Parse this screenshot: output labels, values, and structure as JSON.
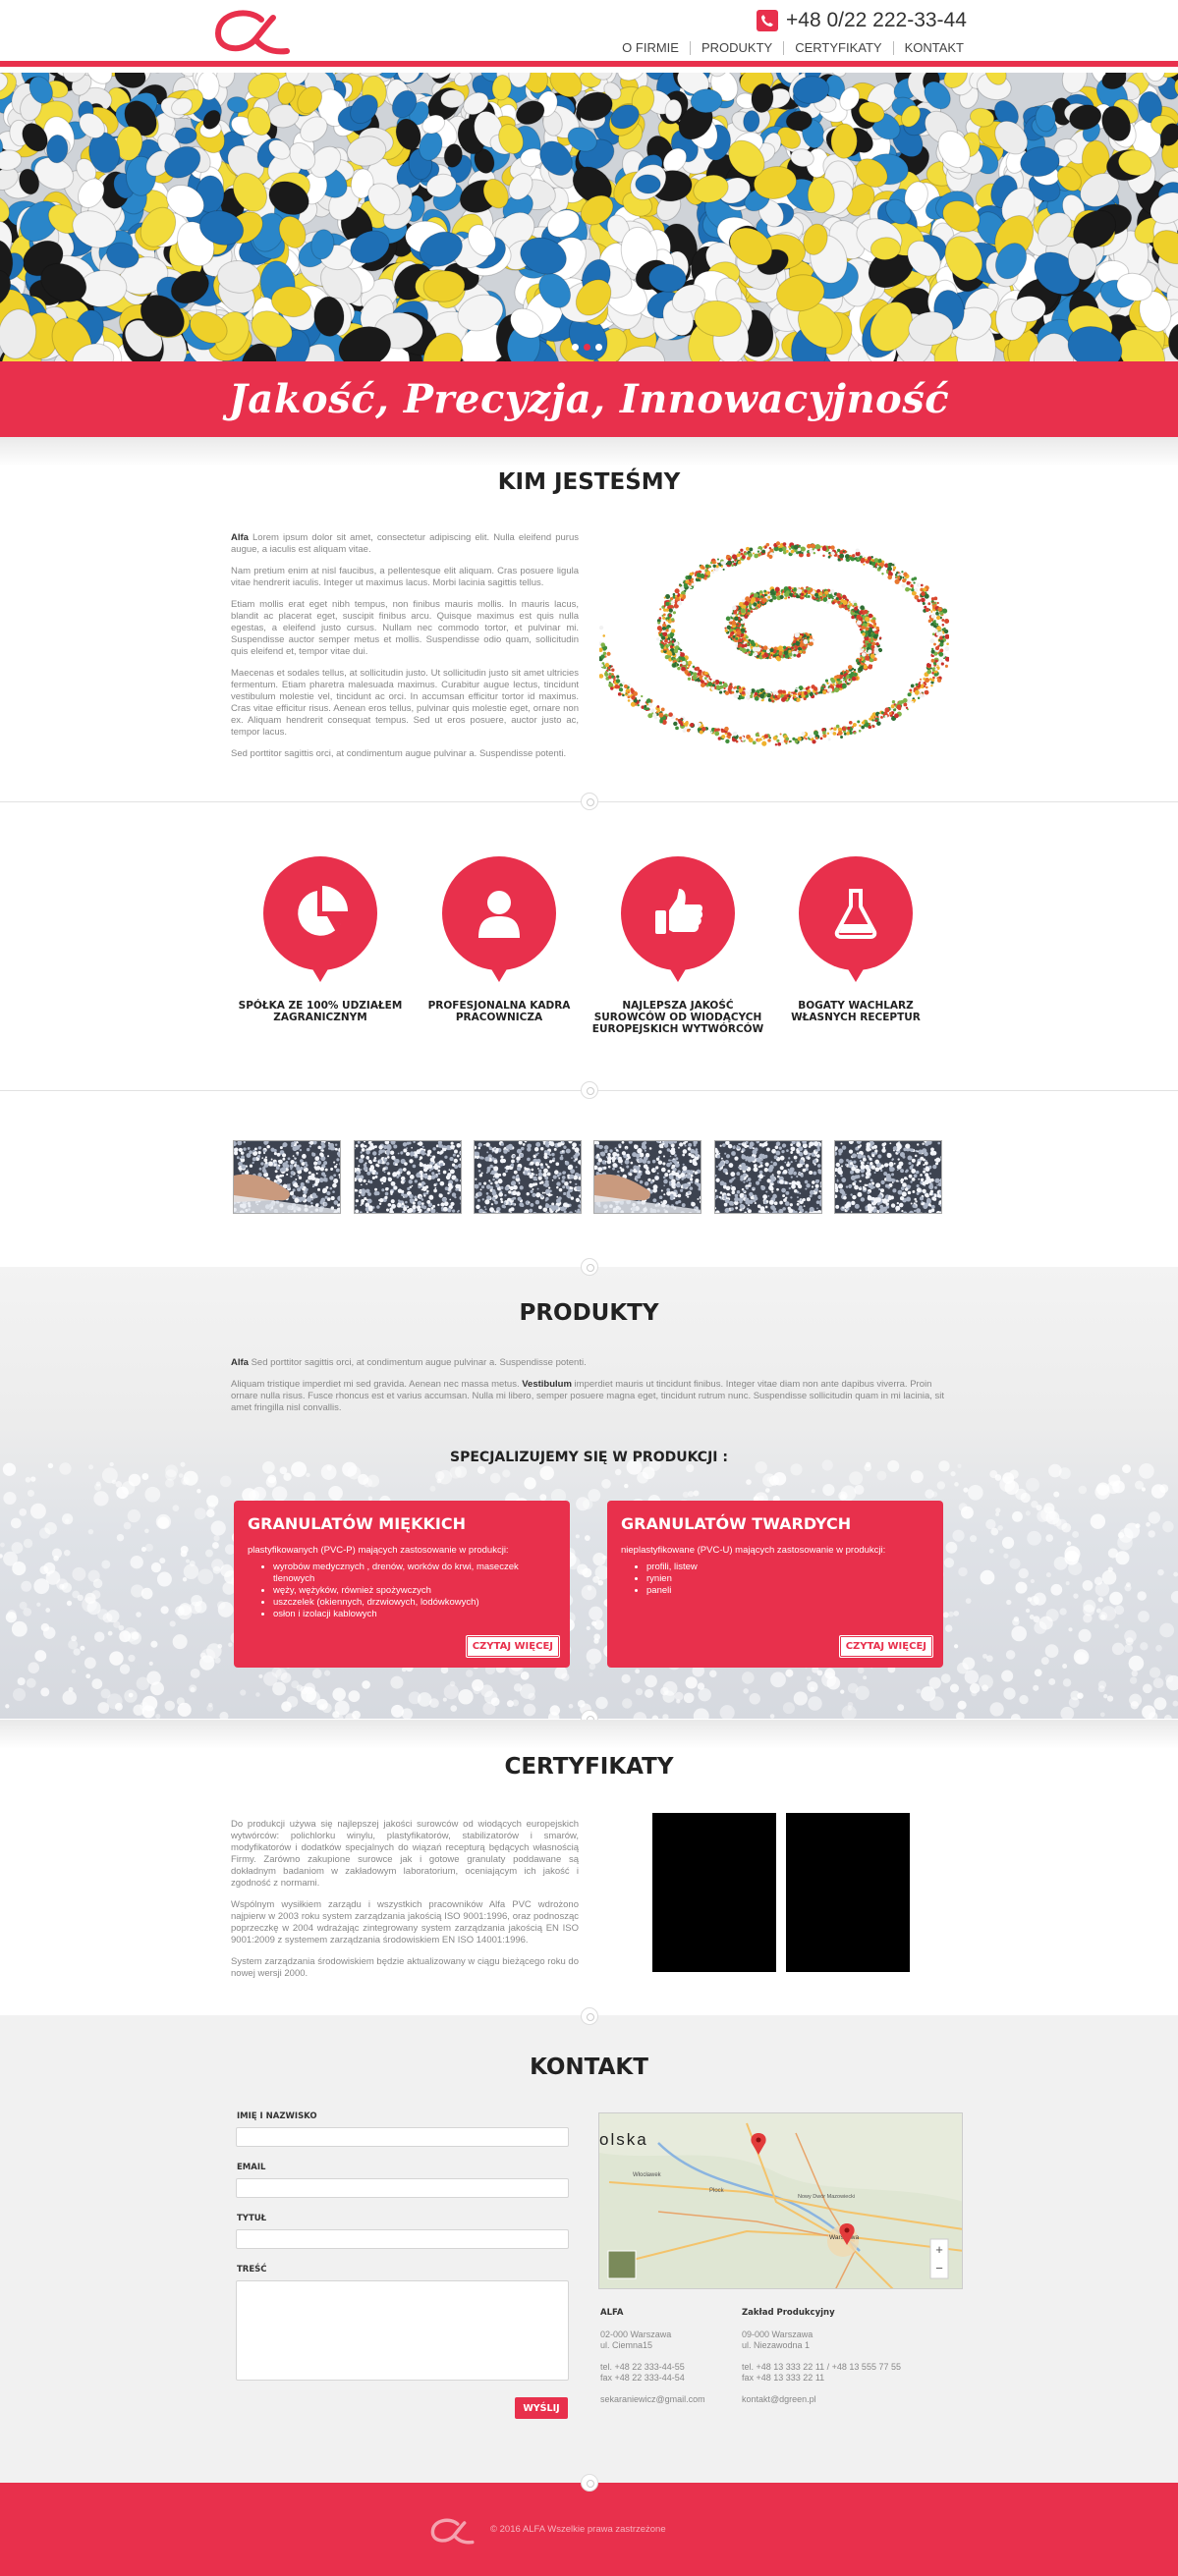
{
  "header": {
    "phone": "+48 0/22 222-33-44",
    "nav": [
      "O FIRMIE",
      "PRODUKTY",
      "CERTYFIKATY",
      "KONTAKT"
    ]
  },
  "hero": {
    "slogan": "Jakość, Precyzja, Innowacyjność",
    "slides": 3,
    "active_slide": 1
  },
  "about": {
    "title": "KIM JESTEŚMY",
    "lead_bold": "Alfa",
    "p1": " Lorem ipsum dolor sit amet, consectetur adipiscing elit. Nulla eleifend purus augue, a iaculis est aliquam vitae.",
    "p2": "Nam pretium enim at nisl faucibus, a pellentesque elit aliquam. Cras posuere ligula vitae hendrerit iaculis. Integer ut maximus lacus. Morbi lacinia sagittis tellus.",
    "p3": "Etiam mollis erat eget nibh tempus, non finibus mauris mollis. In mauris lacus, blandit ac placerat eget, suscipit finibus arcu. Quisque maximus est quis nulla egestas, a eleifend justo cursus. Nullam nec commodo tortor, et pulvinar mi. Suspendisse auctor semper metus et mollis. Suspendisse odio quam, sollicitudin quis eleifend et, tempor vitae dui.",
    "p4": "Maecenas et sodales tellus, at sollicitudin justo. Ut sollicitudin justo sit amet ultricies fermentum. Etiam pharetra malesuada maximus. Curabitur augue lectus, tincidunt vestibulum molestie vel, tincidunt ac orci. In accumsan efficitur tortor id maximus. Cras vitae efficitur risus. Aenean eros tellus, pulvinar quis molestie eget, ornare non ex. Aliquam hendrerit consequat tempus. Sed ut eros posuere, auctor justo ac, tempor lacus.",
    "p5": "Sed porttitor sagittis orci, at condimentum augue pulvinar a. Suspendisse potenti."
  },
  "features": [
    {
      "icon": "pie-chart-icon",
      "text": "SPÓŁKA ZE 100% UDZIAŁEM ZAGRANICZNYM"
    },
    {
      "icon": "user-icon",
      "text": "PROFESJONALNA KADRA PRACOWNICZA"
    },
    {
      "icon": "thumbs-up-icon",
      "text": "NAJLEPSZA JAKOŚĆ SUROWCÓW OD WIODĄCYCH EUROPEJSKICH WYTWÓRCÓW"
    },
    {
      "icon": "flask-icon",
      "text": "BOGATY WACHLARZ WŁASNYCH RECEPTUR"
    }
  ],
  "products": {
    "title": "PRODUKTY",
    "p1_bold": "Alfa",
    "p1": " Sed porttitor sagittis orci, at condimentum augue pulvinar a. Suspendisse potenti.",
    "p2a": "Aliquam tristique imperdiet mi sed gravida. Aenean nec massa metus. ",
    "p2_bold": "Vestibulum",
    "p2b": " imperdiet mauris ut tincidunt finibus. Integer vitae diam non ante dapibus viverra. Proin ornare nulla risus. Fusce rhoncus est et varius accumsan. Nulla mi libero, semper posuere magna eget, tincidunt rutrum nunc. Suspendisse sollicitudin quam in mi lacinia, sit amet fringilla nisl convallis.",
    "subtitle": "SPECJALIZUJEMY SIĘ W PRODUKCJI :",
    "cards": [
      {
        "title": "GRANULATÓW MIĘKKICH",
        "sub": "plastyfikowanych (PVC-P) mających zastosowanie w produkcji:",
        "items": [
          "wyrobów medycznych , drenów, worków do krwi, maseczek tlenowych",
          "węży, wężyków, również spożywczych",
          "uszczelek (okiennych, drzwiowych, lodówkowych)",
          "osłon i izolacji kablowych"
        ],
        "button": "CZYTAJ WIĘCEJ"
      },
      {
        "title": "GRANULATÓW TWARDYCH",
        "sub": "nieplastyfikowane (PVC-U) mających zastosowanie w produkcji:",
        "items": [
          "profili, listew",
          "rynien",
          "paneli"
        ],
        "button": "CZYTAJ WIĘCEJ"
      }
    ]
  },
  "certs": {
    "title": "CERTYFIKATY",
    "p1": "Do produkcji używa się najlepszej jakości surowców od wiodących europejskich wytwórców: polichlorku winylu, plastyfikatorów, stabilizatorów i smarów, modyfikatorów i dodatków specjalnych do wiązań recepturą będących własnością Firmy. Zarówno zakupione surowce jak i gotowe granulaty poddawane są dokładnym badaniom w zakładowym laboratorium, oceniającym ich jakość i zgodność z normami.",
    "p2": "Wspólnym wysiłkiem zarządu i wszystkich pracowników Alfa PVC wdrożono najpierw w 2003 roku system zarządzania jakością ISO 9001:1996, oraz podnosząc poprzeczkę w 2004 wdrażając zintegrowany system zarządzania jakością EN ISO 9001:2009 z systemem zarządzania środowiskiem EN ISO 14001:1996.",
    "p3": "System zarządzania środowiskiem będzie aktualizowany w ciągu bieżącego roku do nowej wersji 2000."
  },
  "contact": {
    "title": "KONTAKT",
    "labels": {
      "name": "IMIĘ I NAZWISKO",
      "email": "EMAIL",
      "subject": "TYTUŁ",
      "message": "TREŚĆ"
    },
    "send": "WYŚLIJ",
    "map_label": "olska",
    "map_towns": [
      "Włocławek",
      "Płock",
      "Nowy Dwór Mazowiecki",
      "Warszawa"
    ],
    "addr1": {
      "name": "ALFA",
      "l1": "02-000 Warszawa",
      "l2": "ul. Ciemna15",
      "l3": "tel. +48 22 333-44-55",
      "l4": "fax +48 22 333-44-54",
      "l5": "sekaraniewicz@gmail.com"
    },
    "addr2": {
      "name": "Zakład Produkcyjny",
      "l1": "09-000 Warszawa",
      "l2": "ul. Niezawodna 1",
      "l3": "tel. +48 13 333 22 11 / +48 13 555 77 55",
      "l4": "fax +48 13 333 22 11",
      "l5": "kontakt@dgreen.pl"
    }
  },
  "footer": {
    "copyright": "© 2016 ALFA Wszelkie prawa zastrzeżone"
  },
  "colors": {
    "accent": "#e8304c"
  }
}
